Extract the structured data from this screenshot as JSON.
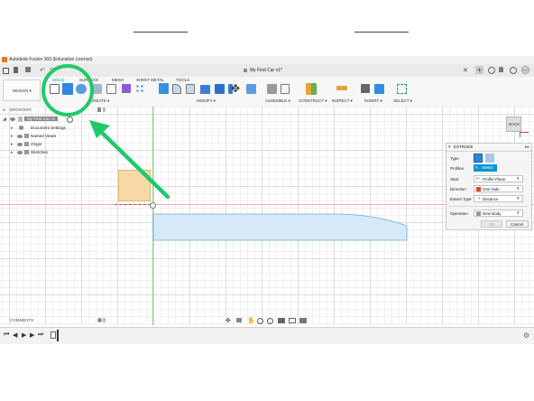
{
  "window": {
    "title": "Autodesk Fusion 360 (Education License)"
  },
  "tabs": {
    "document": "My First Car v1*"
  },
  "workspace": {
    "label": "DESIGN ▾"
  },
  "ribbon_tabs": {
    "solid": "SOLID",
    "surface": "SURFACE",
    "mesh": "MESH",
    "sheet_metal": "SHEET METAL",
    "tools": "TOOLS"
  },
  "ribbon_groups": {
    "create": "CREATE ▾",
    "modify": "MODIFY ▾",
    "assemble": "ASSEMBLE ▾",
    "construct": "CONSTRUCT ▾",
    "inspect": "INSPECT ▾",
    "insert": "INSERT ▾",
    "select": "SELECT ▾"
  },
  "browser": {
    "title": "BROWSER",
    "root": "My First Car v1",
    "items": [
      "Document Settings",
      "Named Views",
      "Origin",
      "Sketches"
    ]
  },
  "viewcube": {
    "label": "BACK"
  },
  "extrude": {
    "title": "EXTRUDE",
    "type_label": "Type",
    "profiles_label": "Profiles",
    "profiles_value": "Select",
    "start_label": "Start",
    "start_value": "Profile Plane",
    "direction_label": "Direction",
    "direction_value": "One Side",
    "extent_label": "Extent Type",
    "extent_value": "Distance",
    "operation_label": "Operation",
    "operation_value": "New Body",
    "ok_label": "OK",
    "cancel_label": "Cancel"
  },
  "comments": {
    "label": "COMMENTS"
  },
  "colors": {
    "annotation": "#1fc96b",
    "accent": "#0696d7",
    "profile_fill": "#f7d9a8",
    "body_fill": "#d6e9f8"
  }
}
